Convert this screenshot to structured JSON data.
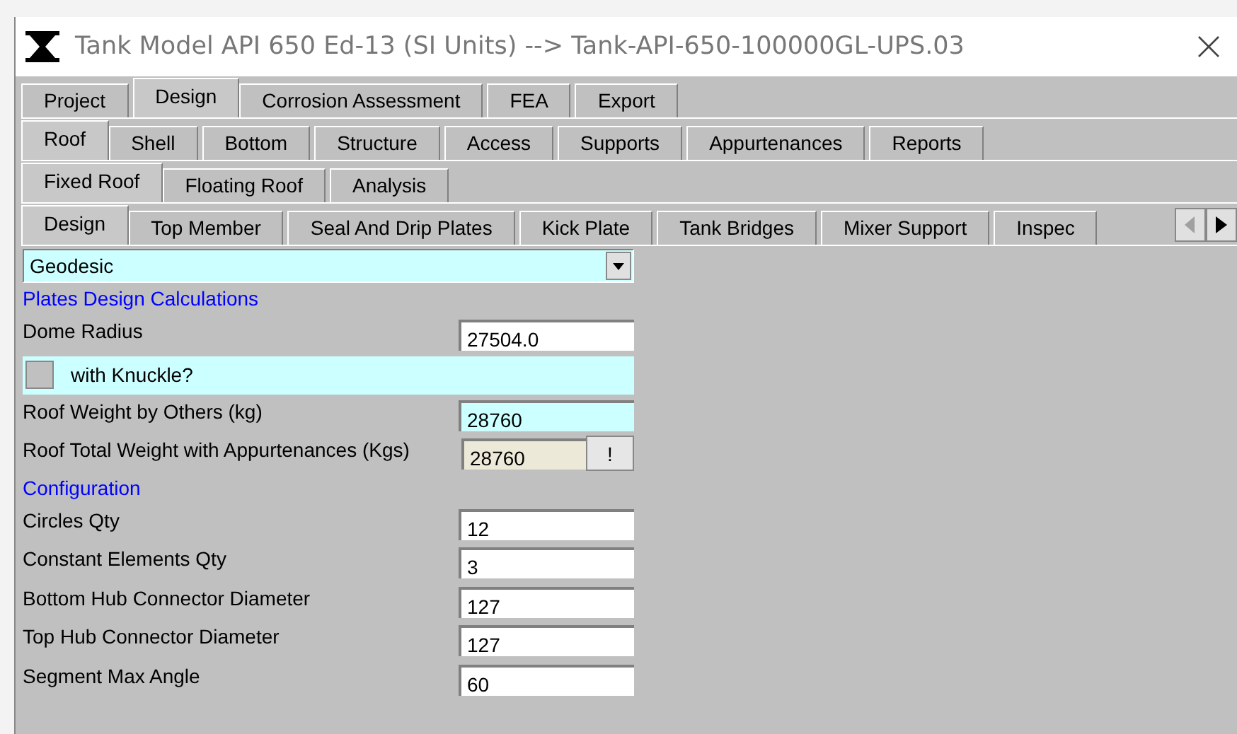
{
  "window": {
    "title": "Tank Model API 650 Ed-13 (SI Units) --> Tank-API-650-100000GL-UPS.03"
  },
  "tab_rows": [
    {
      "tabs": [
        {
          "label": "Project",
          "selected": false
        },
        {
          "label": "Design",
          "selected": true
        },
        {
          "label": "Corrosion Assessment",
          "selected": false
        },
        {
          "label": "FEA",
          "selected": false
        },
        {
          "label": "Export",
          "selected": false
        }
      ]
    },
    {
      "tabs": [
        {
          "label": "Roof",
          "selected": true
        },
        {
          "label": "Shell",
          "selected": false
        },
        {
          "label": "Bottom",
          "selected": false
        },
        {
          "label": "Structure",
          "selected": false
        },
        {
          "label": "Access",
          "selected": false
        },
        {
          "label": "Supports",
          "selected": false
        },
        {
          "label": "Appurtenances",
          "selected": false
        },
        {
          "label": "Reports",
          "selected": false
        }
      ]
    },
    {
      "tabs": [
        {
          "label": "Fixed Roof",
          "selected": true
        },
        {
          "label": "Floating Roof",
          "selected": false
        },
        {
          "label": "Analysis",
          "selected": false
        }
      ]
    },
    {
      "tabs": [
        {
          "label": "Design",
          "selected": true
        },
        {
          "label": "Top Member",
          "selected": false
        },
        {
          "label": "Seal And Drip Plates",
          "selected": false
        },
        {
          "label": "Kick Plate",
          "selected": false
        },
        {
          "label": "Tank Bridges",
          "selected": false
        },
        {
          "label": "Mixer Support",
          "selected": false
        },
        {
          "label": "Inspec",
          "selected": false
        }
      ],
      "scroll_buttons": true
    }
  ],
  "form": [
    {
      "kind": "select",
      "value": "Geodesic"
    },
    {
      "kind": "heading",
      "text": "Plates Design Calculations"
    },
    {
      "kind": "field",
      "label": "Dome Radius",
      "value": "27504.0",
      "highlighted": false,
      "readonly": false
    },
    {
      "kind": "checkbox",
      "label": "with Knuckle?",
      "checked": false
    },
    {
      "kind": "field",
      "label": "Roof Weight by Others (kg)",
      "value": "28760",
      "highlighted": true,
      "readonly": false
    },
    {
      "kind": "field",
      "label": "Roof Total Weight with Appurtenances (Kgs)",
      "value": "28760",
      "highlighted": false,
      "readonly": true,
      "button": "!"
    },
    {
      "kind": "heading",
      "text": "Configuration"
    },
    {
      "kind": "field",
      "label": "Circles Qty",
      "value": "12",
      "highlighted": false,
      "readonly": false
    },
    {
      "kind": "field",
      "label": "Constant Elements Qty",
      "value": "3",
      "highlighted": false,
      "readonly": false
    },
    {
      "kind": "field",
      "label": "Bottom Hub Connector Diameter",
      "value": "127",
      "highlighted": false,
      "readonly": false
    },
    {
      "kind": "field",
      "label": "Top Hub Connector Diameter",
      "value": "127",
      "highlighted": false,
      "readonly": false
    },
    {
      "kind": "field",
      "label": "Segment Max Angle",
      "value": "60",
      "highlighted": false,
      "readonly": false
    }
  ]
}
